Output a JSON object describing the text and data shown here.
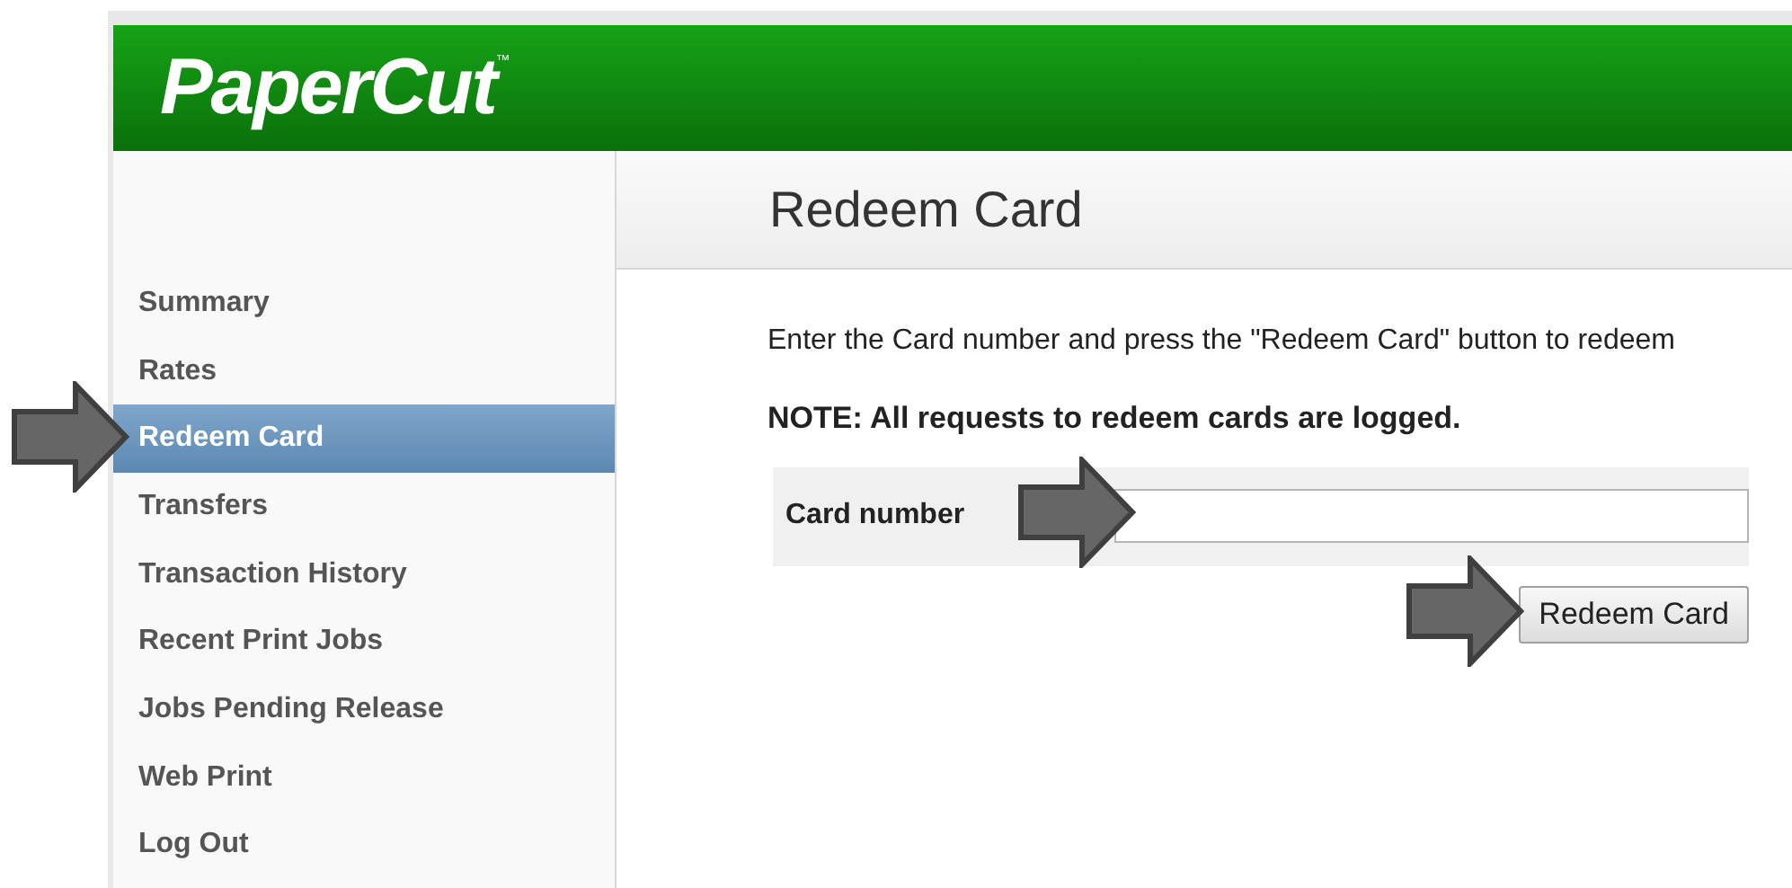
{
  "header": {
    "logo": "PaperCut",
    "trademark": "™"
  },
  "sidebar": {
    "items": [
      {
        "label": "Summary",
        "selected": false
      },
      {
        "label": "Rates",
        "selected": false
      },
      {
        "label": "Redeem Card",
        "selected": true
      },
      {
        "label": "Transfers",
        "selected": false
      },
      {
        "label": "Transaction History",
        "selected": false
      },
      {
        "label": "Recent Print Jobs",
        "selected": false
      },
      {
        "label": "Jobs Pending Release",
        "selected": false
      },
      {
        "label": "Web Print",
        "selected": false
      },
      {
        "label": "Log Out",
        "selected": false
      }
    ]
  },
  "main": {
    "title": "Redeem Card",
    "instructions": "Enter the Card number and press the \"Redeem Card\" button to redeem",
    "note": "NOTE: All requests to redeem cards are logged.",
    "form": {
      "label": "Card number",
      "submit": "Redeem Card"
    }
  }
}
